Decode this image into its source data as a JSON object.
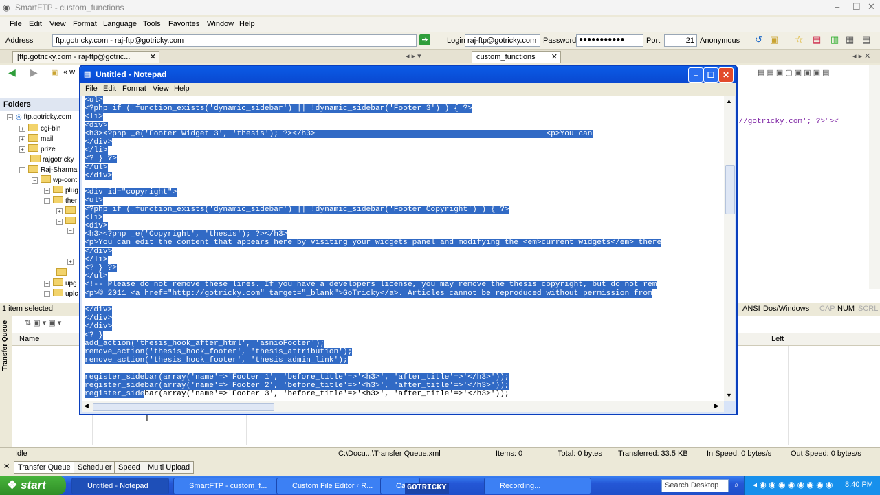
{
  "app": {
    "title": "SmartFTP - custom_functions",
    "menu": [
      "File",
      "Edit",
      "View",
      "Format",
      "Language",
      "Tools",
      "Favorites",
      "Window",
      "Help"
    ]
  },
  "address_bar": {
    "address_label": "Address",
    "address_value": "ftp.gotricky.com - raj-ftp@gotricky.com",
    "login_label": "Login",
    "login_value": "raj-ftp@gotricky.com",
    "password_label": "Password",
    "password_value": "●●●●●●●●●●●",
    "port_label": "Port",
    "port_value": "21",
    "anonymous_label": "Anonymous"
  },
  "tabs": {
    "left_tab": "[ftp.gotricky.com - raj-ftp@gotric...",
    "right_tab": "custom_functions"
  },
  "left_pane": {
    "nav_text": "« w",
    "folders_label": "Folders",
    "tree": [
      {
        "label": "ftp.gotricky.com"
      },
      {
        "label": "cgi-bin"
      },
      {
        "label": "mail"
      },
      {
        "label": "prize"
      },
      {
        "label": "rajgotricky"
      },
      {
        "label": "Raj-Sharma"
      },
      {
        "label": "wp-cont"
      },
      {
        "label": "plug"
      },
      {
        "label": "ther"
      },
      {
        "label": "upg"
      },
      {
        "label": "uplc"
      }
    ],
    "status": "1 item selected"
  },
  "right_pane": {
    "code_fragment": "://gotricky.com'; ?>\"><",
    "encoding": "ANSI",
    "line_endings": "Dos/Windows",
    "cap": "CAP",
    "num": "NUM",
    "scrl": "SCRL"
  },
  "queue": {
    "side_label": "Transfer Queue",
    "col_name": "Name",
    "col_left": "Left",
    "status_idle": "Idle",
    "status_path": "C:\\Docu...\\Transfer Queue.xml",
    "items": "Items: 0",
    "total": "Total: 0 bytes",
    "transferred": "Transferred: 33.5 KB",
    "in_speed": "In Speed: 0 bytes/s",
    "out_speed": "Out Speed: 0 bytes/s",
    "bottom_tabs": [
      "Transfer Queue",
      "Scheduler",
      "Speed",
      "Multi Upload"
    ]
  },
  "notepad": {
    "title": "Untitled - Notepad",
    "menu": [
      "File",
      "Edit",
      "Format",
      "View",
      "Help"
    ],
    "lines": [
      "<ul>",
      "<?php if (!function_exists('dynamic_sidebar') || !dynamic_sidebar('Footer 3') ) { ?>",
      "<li>",
      "<div>",
      "<h3><?php _e('Footer Widget 3', 'thesis'); ?></h3>                                                  <p>You can",
      "</div>",
      "</li>",
      "<? } ?>",
      "</ul>",
      "</div>",
      "",
      "<div id=\"copyright\">",
      "<ul>",
      "<?php if (!function_exists('dynamic_sidebar') || !dynamic_sidebar('Footer Copyright') ) { ?>",
      "<li>",
      "<div>",
      "<h3><?php _e('Copyright', 'thesis'); ?></h3>",
      "<p>You can edit the content that appears here by visiting your widgets panel and modifying the <em>current widgets</em> there",
      "</div>",
      "</li>",
      "<? } ?>",
      "</ul>",
      "<!-- Please do not remove these lines. If you have a developers license, you may remove the thesis copyright, but do not rem",
      "<p>© 2011 <a href=\"http://gotricky.com\" target=\"_blank\">GoTricky</a>. Articles cannot be reproduced without permission from",
      "",
      "</div>",
      "</div>",
      "</div>",
      "<? }",
      "add_action('thesis_hook_after_html', 'asnioFooter');",
      "remove_action('thesis_hook_footer', 'thesis_attribution');",
      "remove_action('thesis_hook_footer', 'thesis_admin_link');",
      "",
      "register_sidebar(array('name'=>'Footer 1', 'before_title'=>'<h3>', 'after_title'=>'</h3>'));",
      "register_sidebar(array('name'=>'Footer 2', 'before_title'=>'<h3>', 'after_title'=>'</h3>'));",
      "register_sidebar(array('name'=>'Footer 3', 'before_title'=>'<h3>', 'after_title'=>'</h3>'));"
    ]
  },
  "taskbar": {
    "start": "start",
    "buttons": [
      "Untitled - Notepad",
      "SmartFTP - custom_f...",
      "Custom File Editor ‹ R...",
      "Ca",
      "Recording..."
    ],
    "watermark": "GOTRICKY",
    "search": "Search Desktop",
    "clock": "8:40 PM"
  },
  "colors": {
    "selection": "#316ac5",
    "xp_title": "#0a49d1",
    "taskbar": "#2457d6"
  }
}
